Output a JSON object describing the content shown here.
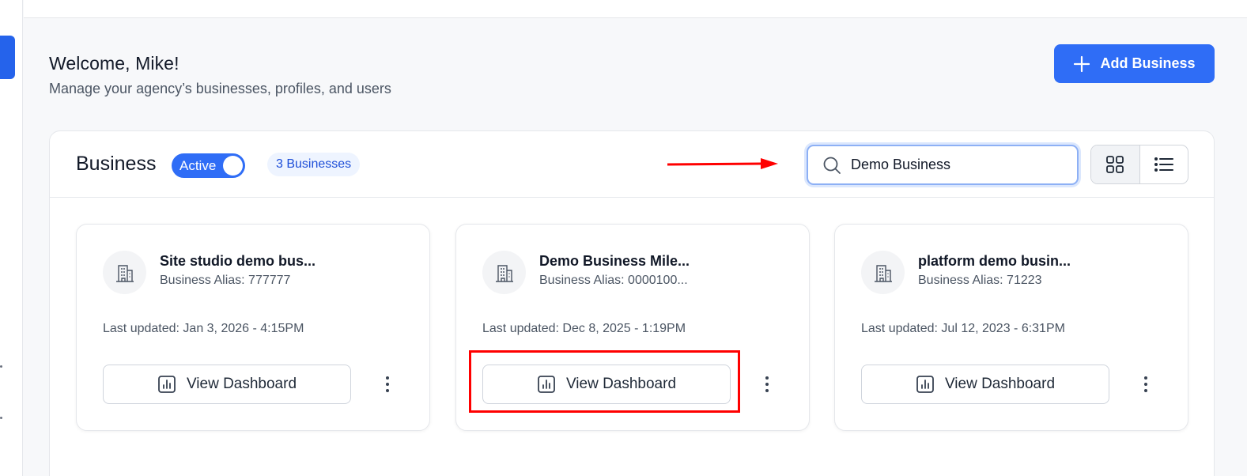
{
  "header": {
    "welcome": "Welcome, Mike!",
    "subtitle": "Manage your agency’s businesses, profiles, and users",
    "add_button_label": "Add Business"
  },
  "business_panel": {
    "title": "Business",
    "status_toggle_label": "Active",
    "count_badge": "3 Businesses",
    "search_value": "Demo Business"
  },
  "cards": [
    {
      "name": "Site studio demo bus...",
      "alias": "Business Alias: 777777",
      "updated": "Last updated: Jan 3, 2026 - 4:15PM",
      "button_label": "View Dashboard"
    },
    {
      "name": "Demo Business Mile...",
      "alias": "Business Alias: 0000100...",
      "updated": "Last updated: Dec 8, 2025 - 1:19PM",
      "button_label": "View Dashboard"
    },
    {
      "name": "platform demo busin...",
      "alias": "Business Alias: 71223",
      "updated": "Last updated: Jul 12, 2023 - 6:31PM",
      "button_label": "View Dashboard"
    }
  ],
  "colors": {
    "primary": "#2f6df6",
    "annotation": "#ff0000"
  }
}
